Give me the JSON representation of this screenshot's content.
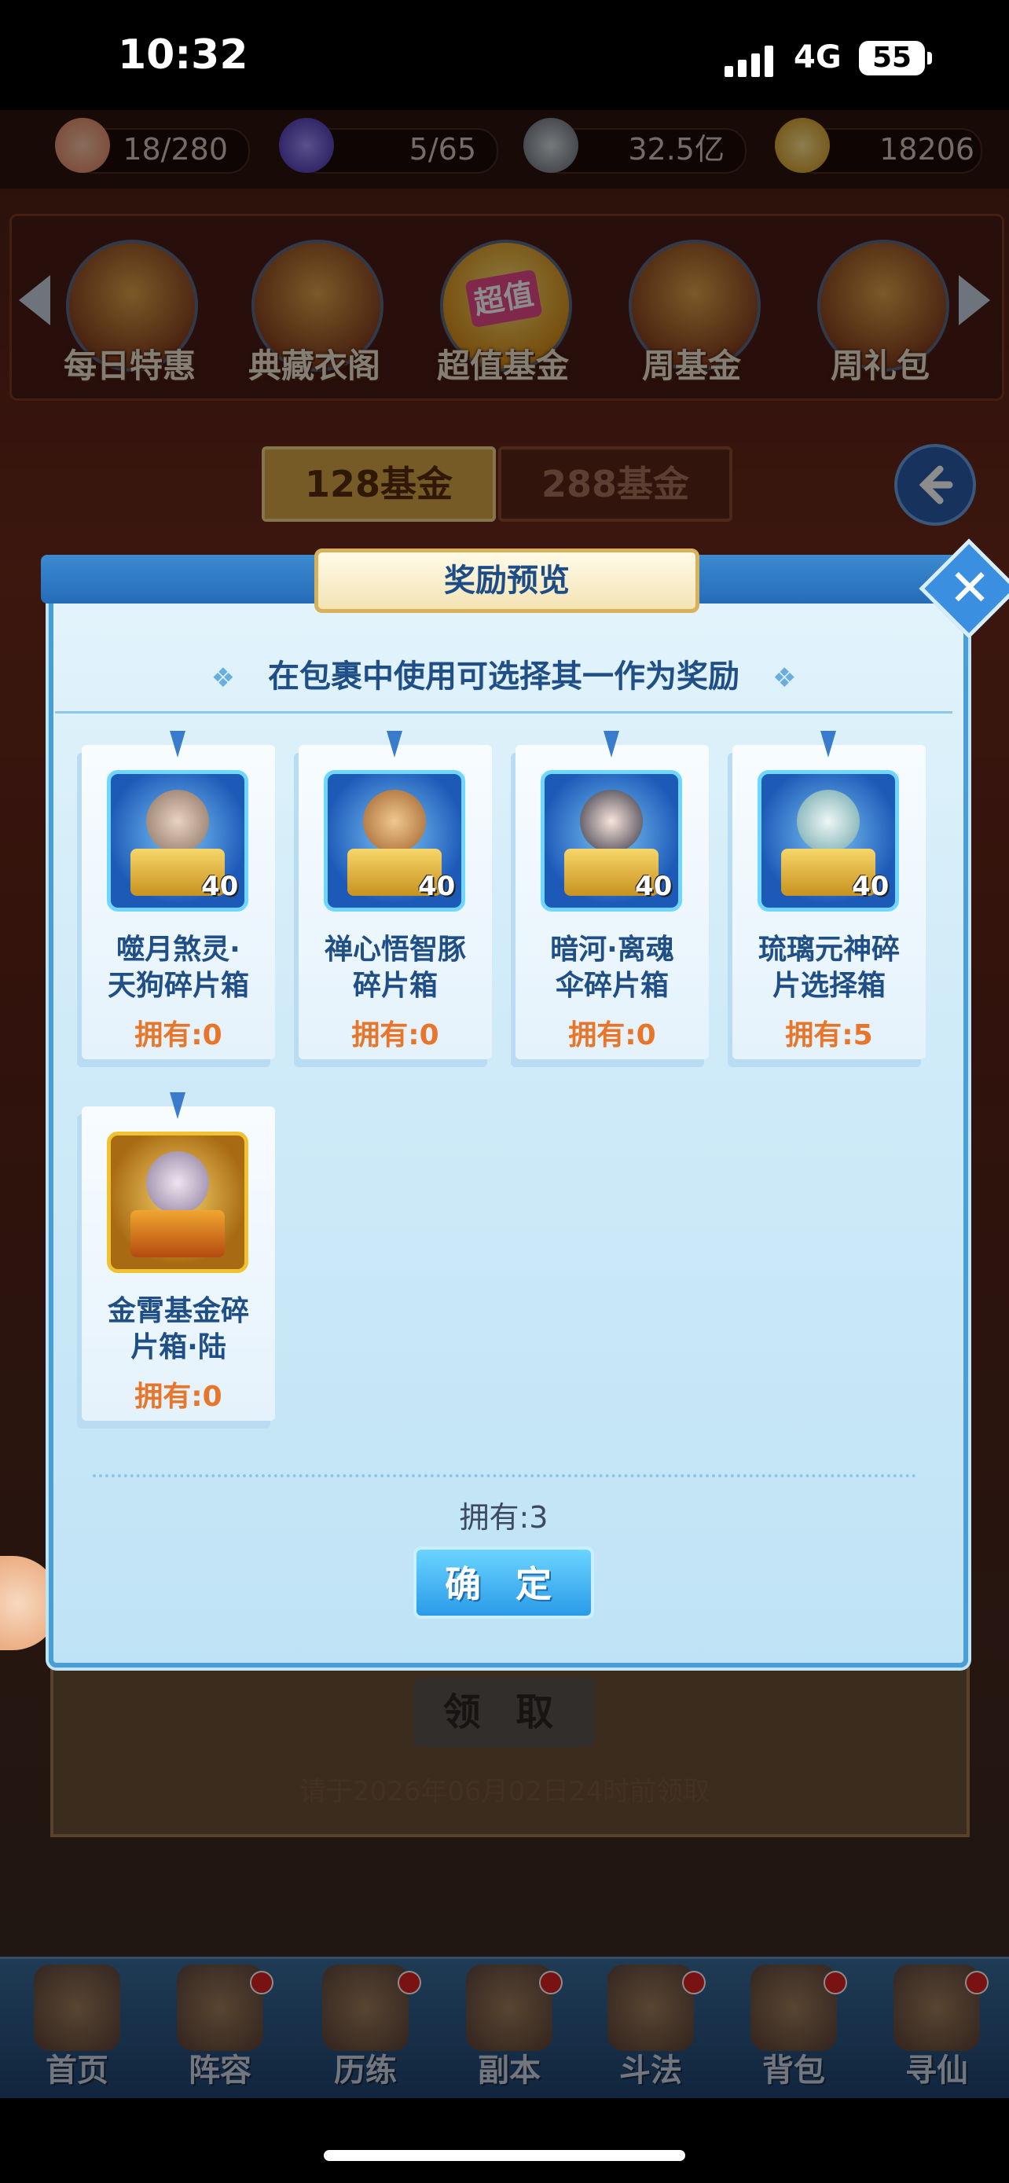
{
  "status_bar": {
    "time": "10:32",
    "network": "4G",
    "battery": "55"
  },
  "resources": [
    {
      "name": "peach-icon",
      "value": "18/280",
      "color": "#f4a48a"
    },
    {
      "name": "spirit-flame-icon",
      "value": "5/65",
      "color": "#6a4ad8"
    },
    {
      "name": "coin-icon",
      "value": "32.5亿",
      "color": "#9aa3ad"
    },
    {
      "name": "gold-ingot-icon",
      "value": "18206",
      "color": "#f2c431"
    }
  ],
  "features": [
    {
      "label": "每日特惠",
      "icon": "daily-deal-icon"
    },
    {
      "label": "典藏衣阁",
      "icon": "wardrobe-icon"
    },
    {
      "label": "超值基金",
      "icon": "super-fund-icon",
      "badge": "超值"
    },
    {
      "label": "周基金",
      "icon": "weekly-fund-icon"
    },
    {
      "label": "周礼包",
      "icon": "weekly-pack-icon"
    }
  ],
  "fund_tabs": [
    "128基金",
    "288基金"
  ],
  "claim": {
    "button": "领 取",
    "deadline": "请于2026年06月02日24时前领取"
  },
  "modal": {
    "title": "奖励预览",
    "subtitle": "在包裹中使用可选择其一作为奖励",
    "items": [
      {
        "name_line1": "噬月煞灵·",
        "name_line2": "天狗碎片箱",
        "count": "40",
        "owned": "拥有:0",
        "icon": "shard-chest-icon",
        "frame": "blue"
      },
      {
        "name_line1": "禅心悟智豚",
        "name_line2": "碎片箱",
        "count": "40",
        "owned": "拥有:0",
        "icon": "shard-chest-icon",
        "frame": "blue"
      },
      {
        "name_line1": "暗河·离魂",
        "name_line2": "伞碎片箱",
        "count": "40",
        "owned": "拥有:0",
        "icon": "shard-chest-icon",
        "frame": "blue"
      },
      {
        "name_line1": "琉璃元神碎",
        "name_line2": "片选择箱",
        "count": "40",
        "owned": "拥有:5",
        "icon": "shard-chest-icon",
        "frame": "blue"
      },
      {
        "name_line1": "金霄基金碎",
        "name_line2": "片箱·陆",
        "count": "",
        "owned": "拥有:0",
        "icon": "gold-shard-chest-icon",
        "frame": "gold"
      }
    ],
    "total_owned": "拥有:3",
    "confirm": "确 定"
  },
  "bottom_nav": [
    "首页",
    "阵容",
    "历练",
    "副本",
    "斗法",
    "背包",
    "寻仙"
  ]
}
